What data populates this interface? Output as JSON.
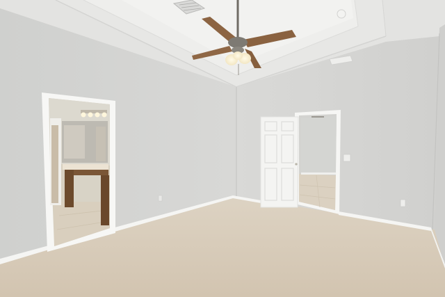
{
  "scene": {
    "kind": "empty-bedroom-photo",
    "objects": [
      "tray-ceiling",
      "ceiling-fan",
      "air-vent",
      "smoke-detector",
      "bathroom-doorway",
      "bathroom-vanity",
      "bathroom-mirror",
      "vanity-light-bar",
      "open-white-panel-door",
      "hallway-doorway",
      "carpet-floor",
      "baseboard",
      "light-switch",
      "wall-outlet"
    ]
  },
  "colors": {
    "wall_left": "#d2d3d1",
    "wall_right": "#d7d7d5",
    "ceiling": "#e4e4e2",
    "tray": "#ecebea",
    "carpet": "#d8ccbb",
    "trim": "#f6f6f4",
    "door": "#f4f4f2",
    "fan_blade": "#8c6442",
    "fan_metal": "#7d7a73",
    "tile": "#d9cfbe",
    "vanity": "#6c4a2c",
    "countertop": "#ece3d3"
  }
}
